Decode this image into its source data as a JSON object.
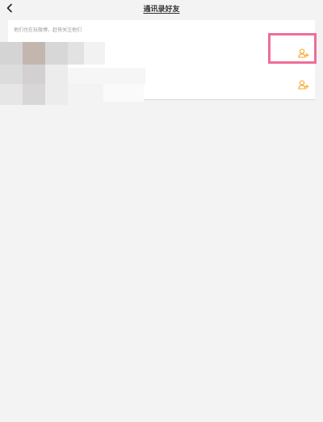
{
  "header": {
    "title": "通讯录好友",
    "back_icon": "chevron-left-icon"
  },
  "contacts_card": {
    "hint": "他们也在玩微博，赶快关注他们",
    "rows": [
      {
        "follow_icon": "add-user-icon"
      },
      {
        "follow_icon": "add-user-icon"
      }
    ]
  },
  "colors": {
    "background": "#f3f3f3",
    "card": "#ffffff",
    "accent_orange": "#f5a623",
    "highlight": "#f06d97"
  }
}
